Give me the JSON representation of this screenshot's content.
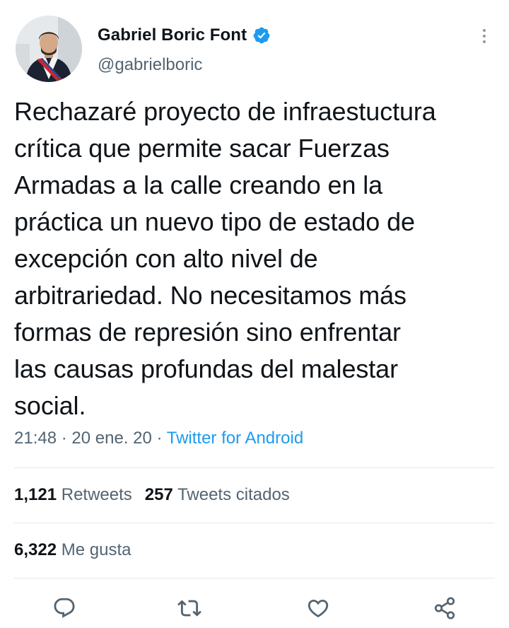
{
  "author": {
    "display_name": "Gabriel Boric Font",
    "handle": "@gabrielboric",
    "verified": true
  },
  "tweet": {
    "lines": [
      "Rechazaré proyecto de infraestuctura",
      "crítica que permite sacar Fuerzas",
      "Armadas a la calle creando en la",
      "práctica un nuevo tipo de estado de",
      "excepción con alto nivel de",
      "arbitrariedad. No necesitamos más",
      "formas de represión sino enfrentar",
      "las causas profundas del malestar",
      "social."
    ],
    "time": "21:48",
    "separator": "·",
    "date": "20 ene. 20",
    "source": "Twitter for Android"
  },
  "stats": {
    "retweets_count": "1,121",
    "retweets_label": "Retweets",
    "quotes_count": "257",
    "quotes_label": "Tweets citados",
    "likes_count": "6,322",
    "likes_label": "Me gusta"
  },
  "actions": [
    "reply-icon",
    "retweet-icon",
    "like-icon",
    "share-icon"
  ],
  "colors": {
    "accent": "#1d9bf0",
    "text": "#0f1419",
    "secondary": "#536471",
    "icon": "#536471",
    "divider": "#e3e7ea"
  }
}
